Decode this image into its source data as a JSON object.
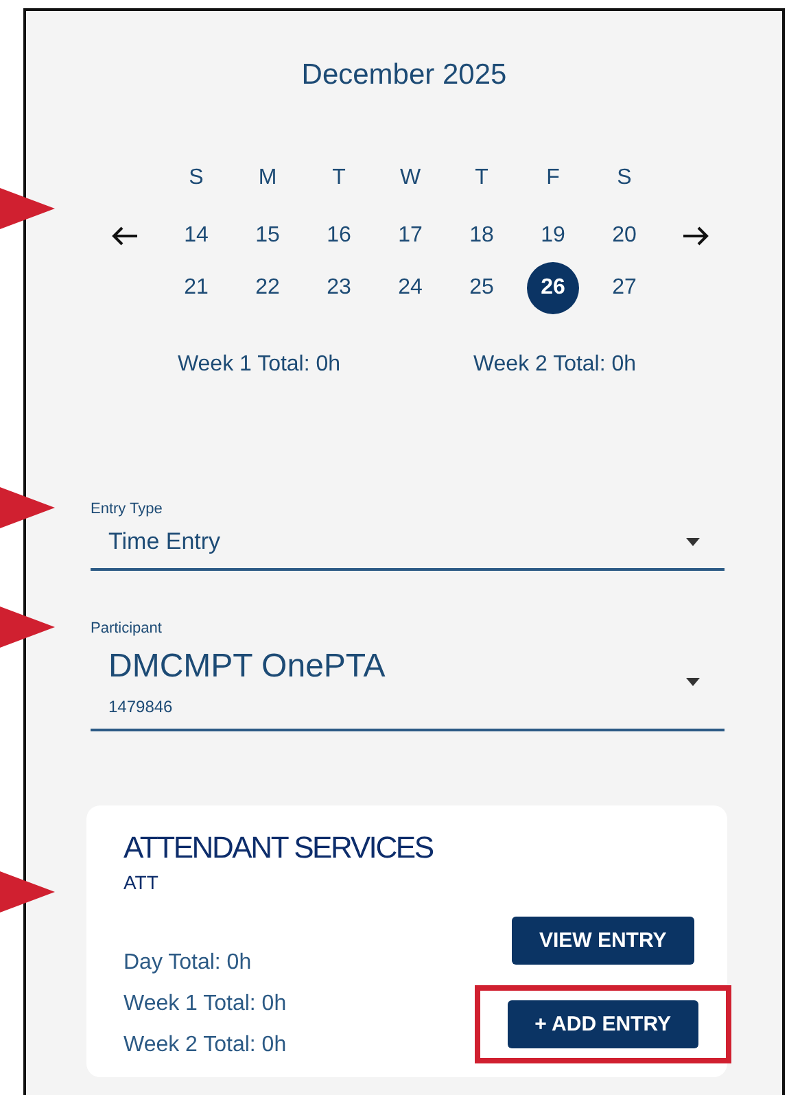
{
  "calendar": {
    "callout_arrow": true,
    "title": "December 2025",
    "weekdays": [
      "S",
      "M",
      "T",
      "W",
      "T",
      "F",
      "S"
    ],
    "weeks": [
      [
        {
          "day": "14",
          "selected": false
        },
        {
          "day": "15",
          "selected": false
        },
        {
          "day": "16",
          "selected": false
        },
        {
          "day": "17",
          "selected": false
        },
        {
          "day": "18",
          "selected": false
        },
        {
          "day": "19",
          "selected": false
        },
        {
          "day": "20",
          "selected": false
        }
      ],
      [
        {
          "day": "21",
          "selected": false
        },
        {
          "day": "22",
          "selected": false
        },
        {
          "day": "23",
          "selected": false
        },
        {
          "day": "24",
          "selected": false
        },
        {
          "day": "25",
          "selected": false
        },
        {
          "day": "26",
          "selected": true
        },
        {
          "day": "27",
          "selected": false
        }
      ]
    ],
    "week_totals": [
      "Week 1 Total: 0h",
      "Week 2 Total: 0h"
    ]
  },
  "entry_type": {
    "callout_arrow": true,
    "label": "Entry Type",
    "value": "Time Entry"
  },
  "participant": {
    "callout_arrow": true,
    "label": "Participant",
    "value": "DMCMPT OnePTA",
    "sub_value": "1479846"
  },
  "service_card": {
    "callout_arrow": true,
    "title": "ATTENDANT SERVICES",
    "code": "ATT",
    "totals": [
      "Day Total: 0h",
      "Week 1 Total: 0h",
      "Week 2 Total: 0h"
    ],
    "buttons": [
      {
        "label": "VIEW ENTRY",
        "highlighted": false
      },
      {
        "label": "+ ADD ENTRY",
        "highlighted": true
      }
    ]
  }
}
